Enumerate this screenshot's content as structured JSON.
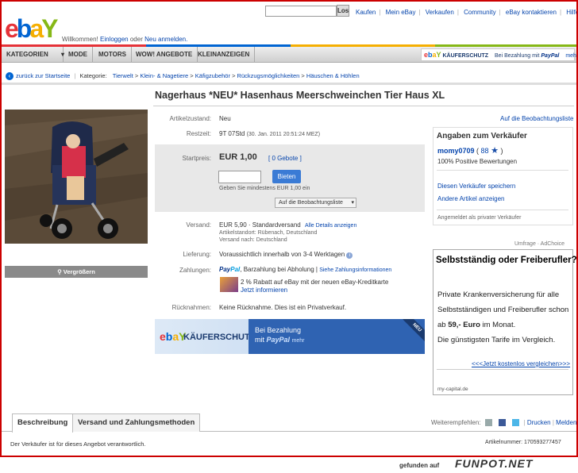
{
  "header": {
    "welcome_prefix": "Willkommen!",
    "login": "Einloggen",
    "or": "oder",
    "register": "Neu anmelden.",
    "search_button": "Los",
    "links": [
      "Kaufen",
      "Mein eBay",
      "Verkaufen",
      "Community",
      "eBay kontaktieren",
      "Hilfe"
    ]
  },
  "nav": {
    "categories": "KATEGORIEN",
    "items": [
      "MODE",
      "MOTORS",
      "WOW! ANGEBOTE",
      "KLEINANZEIGEN"
    ],
    "kaeuferschutz": "KÄUFERSCHUTZ",
    "paypal_note": "Bei Bezahlung mit",
    "paypal": "PayPal",
    "more": "mehr"
  },
  "breadcrumb": {
    "back": "zurück zur Startseite",
    "label": "Kategorie:",
    "path": [
      "Tierwelt",
      "Klein- & Nagetiere",
      "Käfigzubehör",
      "Rückzugsmöglichkeiten",
      "Häuschen & Höhlen"
    ]
  },
  "item": {
    "title": "Nagerhaus *NEU* Hasenhaus Meerschweinchen Tier Haus XL",
    "enlarge": "Vergrößern",
    "condition_label": "Artikelzustand:",
    "condition": "Neu",
    "time_label": "Restzeit:",
    "time": "9T 07Std",
    "time_end": "(30. Jan. 2011 20:51:24 MEZ)",
    "start_label": "Startpreis:",
    "price": "EUR 1,00",
    "bids": "[ 0 Gebote ]",
    "bid_button": "Bieten",
    "min_bid": "Geben Sie mindestens EUR 1,00 ein",
    "watch_button": "Auf die Beobachtungsliste",
    "shipping_label": "Versand:",
    "shipping_price": "EUR 5,90",
    "shipping_type": "Standardversand",
    "shipping_details": "Alle Details anzeigen",
    "location": "Artikelstandort: Rübenach, Deutschland",
    "ships_to": "Versand nach: Deutschland",
    "delivery_label": "Lieferung:",
    "delivery": "Voraussichtlich innerhalb von 3-4 Werktagen",
    "payment_label": "Zahlungen:",
    "payment": ", Barzahlung bei Abholung |",
    "payment_info": "Siehe Zahlungsinformationen",
    "discount": "2 % Rabatt auf eBay mit der neuen eBay-Kreditkarte",
    "discount_link": "Jetzt informieren",
    "returns_label": "Rücknahmen:",
    "returns": "Keine Rücknahme. Dies ist ein Privatverkauf."
  },
  "banner": {
    "ks": "KÄUFERSCHUTZ",
    "line1": "Bei Bezahlung",
    "line2": "mit",
    "paypal": "PayPal",
    "more": "mehr",
    "ribbon": "NEU"
  },
  "seller": {
    "watchlist": "Auf die Beobachtungsliste",
    "heading": "Angaben zum Verkäufer",
    "name": "momy0709",
    "score": "88",
    "positive": "100% Positive Bewertungen",
    "save": "Diesen Verkäufer speichern",
    "other": "Andere Artikel anzeigen",
    "private": "Angemeldet als privater Verkäufer"
  },
  "ad": {
    "label": "Umfrage · AdChoice",
    "title": "Selbstständig oder Freiberufler?",
    "text1": "Private Krankenversicherung für alle Selbstständigen und Freiberufler schon ab ",
    "price": "59,- Euro",
    "text2": " im Monat.",
    "text3": "Die günstigsten Tarife im Vergleich.",
    "link": "<<<Jetzt kostenlos vergleichen>>>",
    "footer": "my-capital.de"
  },
  "tabs": [
    "Beschreibung",
    "Versand und Zahlungsmethoden"
  ],
  "share": {
    "label": "Weiterempfehlen:",
    "print": "Drucken",
    "report": "Melden"
  },
  "footer": {
    "note": "Der Verkäufer ist für dieses Angebot verantwortlich.",
    "artnr": "Artikelnummer: 170593277457"
  },
  "watermark": {
    "text": "gefunden auf",
    "logo": "FUNPOT.NET"
  },
  "colors": {
    "ebay_red": "#e53238",
    "ebay_blue": "#0064d2",
    "ebay_yellow": "#f5af02",
    "ebay_green": "#86b817",
    "frame": "#cc0000"
  }
}
